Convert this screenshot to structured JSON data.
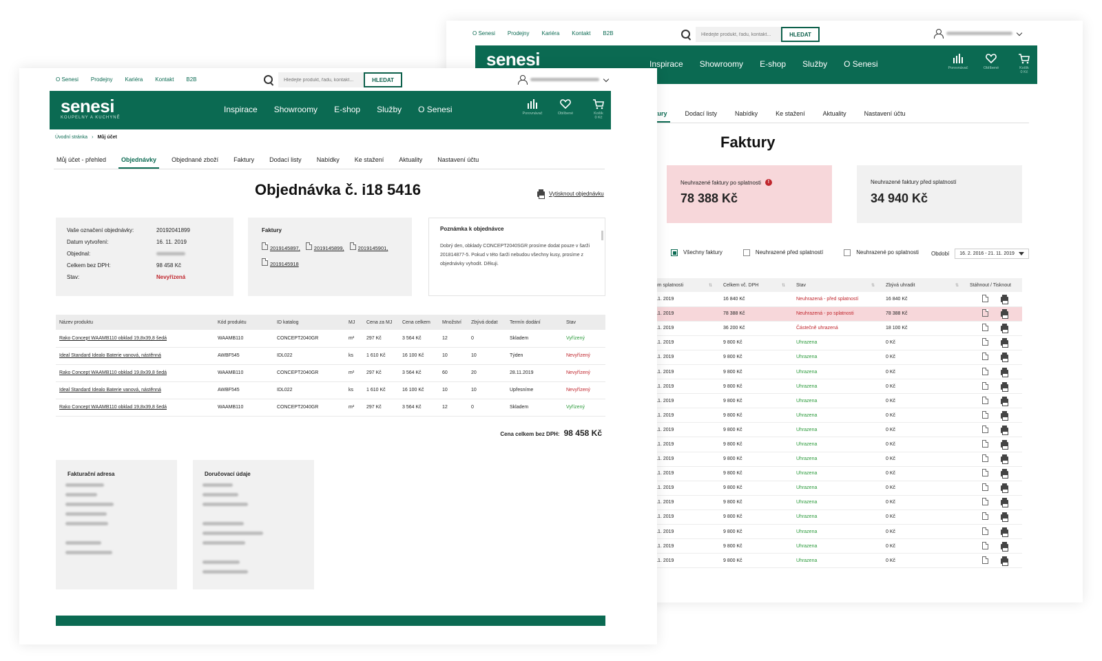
{
  "top_links": [
    "O Senesi",
    "Prodejny",
    "Kariéra",
    "Kontakt",
    "B2B"
  ],
  "search": {
    "placeholder": "Hledejte produkt, řadu, kontakt...",
    "button": "HLEDAT"
  },
  "logo": {
    "name": "senesi",
    "tagline": "KOUPELNY A KUCHYNĚ"
  },
  "nav": [
    "Inspirace",
    "Showroomy",
    "E-shop",
    "Služby",
    "O Senesi"
  ],
  "nav_icons": [
    {
      "label": "Porovnávač",
      "icon": "compare-icon"
    },
    {
      "label": "Oblíbené",
      "icon": "heart-icon"
    },
    {
      "label": "Košík",
      "sub": "0 Kč",
      "icon": "cart-icon"
    }
  ],
  "brand_color": "#0b6a52",
  "back": {
    "tabs": [
      "Faktury",
      "Dodací listy",
      "Nabídky",
      "Ke stažení",
      "Aktuality",
      "Nastavení účtu"
    ],
    "title": "Faktury",
    "summary": [
      {
        "label": "Neuhrazené faktury po splatnosti",
        "value": "78 388 Kč",
        "alert": true
      },
      {
        "label": "Neuhrazené faktury před splatností",
        "value": "34 940 Kč",
        "alert": false
      }
    ],
    "filters": [
      {
        "label": "Všechny faktury",
        "checked": true
      },
      {
        "label": "Neuhrazené před splatností",
        "checked": false
      },
      {
        "label": "Neuhrazené po splatnosti",
        "checked": false
      }
    ],
    "period_label": "Období",
    "period_value": "16. 2. 2016 - 21. 11. 2019",
    "columns": [
      "Datum splatnosti",
      "Celkem vč. DPH",
      "Stav",
      "Zbývá uhradit",
      "Stáhnout / Tisknout"
    ],
    "rows": [
      {
        "date": "24. 11. 2019",
        "total": "16 840 Kč",
        "state": "Neuhrazená - před splatností",
        "rest": "16 840 Kč",
        "status": "bad"
      },
      {
        "date": "17. 11. 2019",
        "total": "78 388 Kč",
        "state": "Neuhrazená - po splatnosti",
        "rest": "78 388 Kč",
        "status": "bad",
        "highlight": true
      },
      {
        "date": "16. 11. 2019",
        "total": "36 200 Kč",
        "state": "Částečně uhrazená",
        "rest": "18 100 Kč",
        "status": "bad"
      },
      {
        "date": "15. 11. 2019",
        "total": "9 800 Kč",
        "state": "Uhrazena",
        "rest": "0 Kč",
        "status": "ok"
      },
      {
        "date": "15. 11. 2019",
        "total": "9 800 Kč",
        "state": "Uhrazena",
        "rest": "0 Kč",
        "status": "ok"
      },
      {
        "date": "15. 11. 2019",
        "total": "9 800 Kč",
        "state": "Uhrazena",
        "rest": "0 Kč",
        "status": "ok"
      },
      {
        "date": "15. 11. 2019",
        "total": "9 800 Kč",
        "state": "Uhrazena",
        "rest": "0 Kč",
        "status": "ok"
      },
      {
        "date": "15. 11. 2019",
        "total": "9 800 Kč",
        "state": "Uhrazena",
        "rest": "0 Kč",
        "status": "ok"
      },
      {
        "date": "15. 11. 2019",
        "total": "9 800 Kč",
        "state": "Uhrazena",
        "rest": "0 Kč",
        "status": "ok"
      },
      {
        "date": "15. 11. 2019",
        "total": "9 800 Kč",
        "state": "Uhrazena",
        "rest": "0 Kč",
        "status": "ok"
      },
      {
        "date": "15. 11. 2019",
        "total": "9 800 Kč",
        "state": "Uhrazena",
        "rest": "0 Kč",
        "status": "ok"
      },
      {
        "date": "15. 11. 2019",
        "total": "9 800 Kč",
        "state": "Uhrazena",
        "rest": "0 Kč",
        "status": "ok"
      },
      {
        "date": "15. 11. 2019",
        "total": "9 800 Kč",
        "state": "Uhrazena",
        "rest": "0 Kč",
        "status": "ok"
      },
      {
        "date": "15. 11. 2019",
        "total": "9 800 Kč",
        "state": "Uhrazena",
        "rest": "0 Kč",
        "status": "ok"
      },
      {
        "date": "15. 11. 2019",
        "total": "9 800 Kč",
        "state": "Uhrazena",
        "rest": "0 Kč",
        "status": "ok"
      },
      {
        "date": "15. 11. 2019",
        "total": "9 800 Kč",
        "state": "Uhrazena",
        "rest": "0 Kč",
        "status": "ok"
      },
      {
        "date": "15. 11. 2019",
        "total": "9 800 Kč",
        "state": "Uhrazena",
        "rest": "0 Kč",
        "status": "ok"
      },
      {
        "date": "15. 11. 2019",
        "total": "9 800 Kč",
        "state": "Uhrazena",
        "rest": "0 Kč",
        "status": "ok"
      },
      {
        "date": "15. 11. 2019",
        "total": "9 800 Kč",
        "state": "Uhrazena",
        "rest": "0 Kč",
        "status": "ok"
      }
    ]
  },
  "front": {
    "breadcrumb": [
      "Úvodní stránka",
      "Můj účet"
    ],
    "tabs": [
      "Můj účet - přehled",
      "Objednávky",
      "Objednané zboží",
      "Faktury",
      "Dodací listy",
      "Nabídky",
      "Ke stažení",
      "Aktuality",
      "Nastavení účtu"
    ],
    "active_tab": 1,
    "title": "Objednávka č. i18 5416",
    "print": "Vytisknout objednávku",
    "info": [
      {
        "k": "Vaše označení objednávky:",
        "v": "20192041899"
      },
      {
        "k": "Datum vytvoření:",
        "v": "16. 11. 2019"
      },
      {
        "k": "Objednal:",
        "v": ""
      },
      {
        "k": "Celkem bez DPH:",
        "v": "98 458 Kč"
      },
      {
        "k": "Stav:",
        "v": "Nevyřízená",
        "red": true
      }
    ],
    "invoices_title": "Faktury",
    "invoices": [
      "2019145897,",
      "2019145899,",
      "2019145901,",
      "2019145918"
    ],
    "note_title": "Poznámka k objednávce",
    "note": "Dobrý den, obklady CONCEPT2040SGR prosíme dodat pouze v šarži 201814877-5. Pokud v této šarži nebudou všechny kusy, prosíme z objednávky vyhodit. Děkuji.",
    "columns": [
      "Název produktu",
      "Kód produktu",
      "ID katalog",
      "MJ",
      "Cena za MJ",
      "Cena celkem",
      "Množství",
      "Zbývá dodat",
      "Termín dodání",
      "Stav"
    ],
    "rows": [
      {
        "name": "Rako Concept WAAMB110 obklad 19,8x39,8 šedá",
        "code": "WAAMB110",
        "cat": "CONCEPT2040GR",
        "mj": "m²",
        "unit": "297 Kč",
        "total": "3 564 Kč",
        "qty": "12",
        "rest": "0",
        "term": "Skladem",
        "state": "Vyřízený",
        "status": "ok"
      },
      {
        "name": "Ideal Standard Idealo Baterie vanová, nástěnná",
        "code": "AWBF545",
        "cat": "IDL022",
        "mj": "ks",
        "unit": "1 610 Kč",
        "total": "16 100 Kč",
        "qty": "10",
        "rest": "10",
        "term": "Týden",
        "state": "Nevyřízený",
        "status": "bad"
      },
      {
        "name": "Rako Concept WAAMB110 obklad 19,8x39,8 šedá",
        "code": "WAAMB110",
        "cat": "CONCEPT2040GR",
        "mj": "m²",
        "unit": "297 Kč",
        "total": "3 564 Kč",
        "qty": "60",
        "rest": "20",
        "term": "28.11.2019",
        "state": "Nevyřízený",
        "status": "bad"
      },
      {
        "name": "Ideal Standard Idealo Baterie vanová, nástěnná",
        "code": "AWBF545",
        "cat": "IDL022",
        "mj": "ks",
        "unit": "1 610 Kč",
        "total": "16 100 Kč",
        "qty": "10",
        "rest": "10",
        "term": "Upřesníme",
        "state": "Nevyřízený",
        "status": "bad"
      },
      {
        "name": "Rako Concept WAAMB110 obklad 19,8x39,8 šedá",
        "code": "WAAMB110",
        "cat": "CONCEPT2040GR",
        "mj": "m²",
        "unit": "297 Kč",
        "total": "3 564 Kč",
        "qty": "12",
        "rest": "0",
        "term": "Skladem",
        "state": "Vyřízený",
        "status": "ok"
      }
    ],
    "total_label": "Cena celkem bez DPH:",
    "total_value": "98 458 Kč",
    "billing_title": "Fakturační adresa",
    "delivery_title": "Doručovací údaje"
  }
}
